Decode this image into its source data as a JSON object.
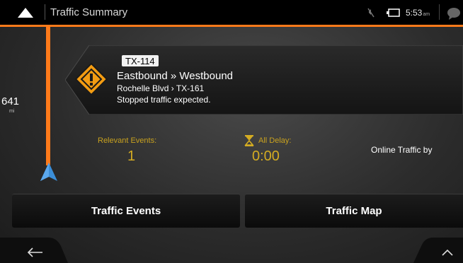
{
  "header": {
    "title": "Traffic Summary",
    "clock": "5:53",
    "clock_suffix": "am"
  },
  "route": {
    "distance": "641",
    "distance_unit": "mi"
  },
  "event": {
    "road": "TX-114",
    "direction": "Eastbound » Westbound",
    "location": "Rochelle Blvd › TX-161",
    "message": "Stopped traffic expected."
  },
  "stats": {
    "relevant_label": "Relevant Events:",
    "relevant_value": "1",
    "delay_label": "All Delay:",
    "delay_value": "0:00",
    "online_traffic": "Online Traffic by"
  },
  "buttons": {
    "traffic_events": "Traffic Events",
    "traffic_map": "Traffic Map"
  },
  "colors": {
    "accent": "#ff7a1a",
    "stat_gold": "#d4ac22",
    "warning_orange": "#f39c12",
    "marker_blue": "#3b8ed8"
  },
  "icons": [
    "back-icon",
    "mute-icon",
    "battery-icon",
    "chat-icon",
    "warning-icon",
    "hourglass-icon",
    "position-arrow-icon",
    "back-arrow-icon",
    "chevron-up-icon"
  ]
}
